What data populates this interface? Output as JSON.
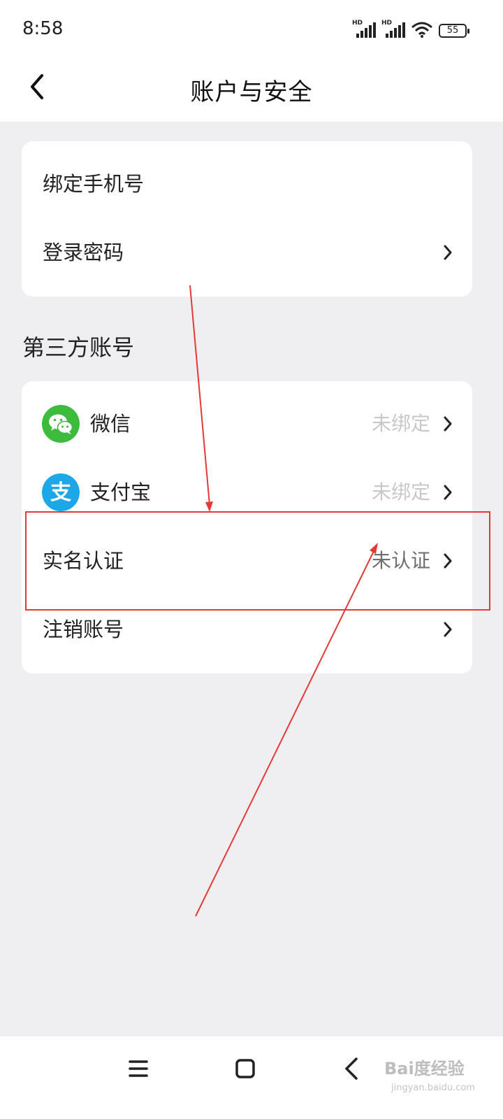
{
  "status_bar": {
    "time": "8:58",
    "signal_1_label": "HD",
    "signal_2_label": "HD",
    "wifi_icon": "wifi-icon",
    "battery": "55"
  },
  "header": {
    "title": "账户与安全",
    "back_icon": "chevron-left-icon"
  },
  "account_card": {
    "items": [
      {
        "label": "绑定手机号",
        "value": "",
        "chevron": false
      },
      {
        "label": "登录密码",
        "value": "",
        "chevron": true
      }
    ]
  },
  "third_party": {
    "section_title": "第三方账号",
    "items": [
      {
        "label": "微信",
        "icon": "wechat-icon",
        "icon_color": "#3dbb3d",
        "value": "未绑定"
      },
      {
        "label": "支付宝",
        "icon": "alipay-icon",
        "icon_color": "#1ea7e8",
        "icon_text": "支",
        "value": "未绑定"
      },
      {
        "label": "实名认证",
        "icon": "",
        "value": "未认证"
      },
      {
        "label": "注销账号",
        "icon": "",
        "value": ""
      }
    ]
  },
  "annotation": {
    "highlight_color": "#e53935"
  },
  "nav_bar": {
    "menu_icon": "menu-icon",
    "home_icon": "home-square-icon",
    "back_icon": "back-chevron-icon"
  },
  "watermark": {
    "logo": "Bai度经验",
    "url": "jingyan.baidu.com"
  }
}
